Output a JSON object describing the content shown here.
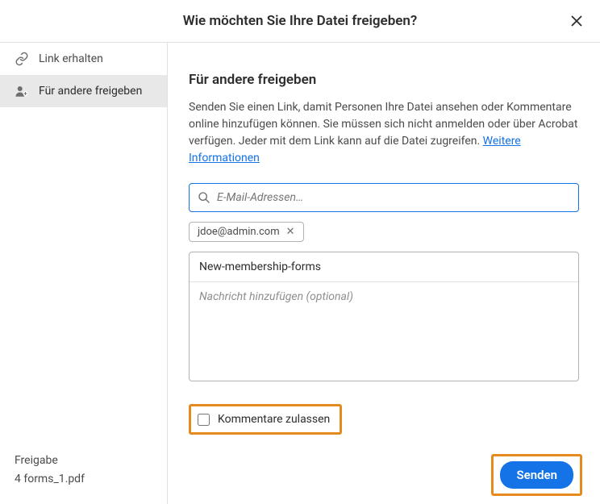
{
  "header": {
    "title": "Wie möchten Sie Ihre Datei freigeben?"
  },
  "sidebar": {
    "items": [
      {
        "label": "Link erhalten"
      },
      {
        "label": "Für andere freigeben"
      }
    ],
    "footer": {
      "label": "Freigabe",
      "filename": "4 forms_1.pdf"
    }
  },
  "main": {
    "heading": "Für andere freigeben",
    "description_pre": "Senden Sie einen Link, damit Personen Ihre Datei ansehen oder Kommentare online hinzufügen können. Sie müssen sich nicht anmelden oder über Acrobat verfügen. Jeder mit dem Link kann auf die Datei zugreifen. ",
    "more_info_link": "Weitere Informationen",
    "email_placeholder": "E-Mail-Adressen…",
    "recipient_chip": "jdoe@admin.com",
    "subject": "New-membership-forms",
    "message_placeholder": "Nachricht hinzufügen (optional)",
    "allow_comments_label": "Kommentare zulassen",
    "send_label": "Senden"
  }
}
